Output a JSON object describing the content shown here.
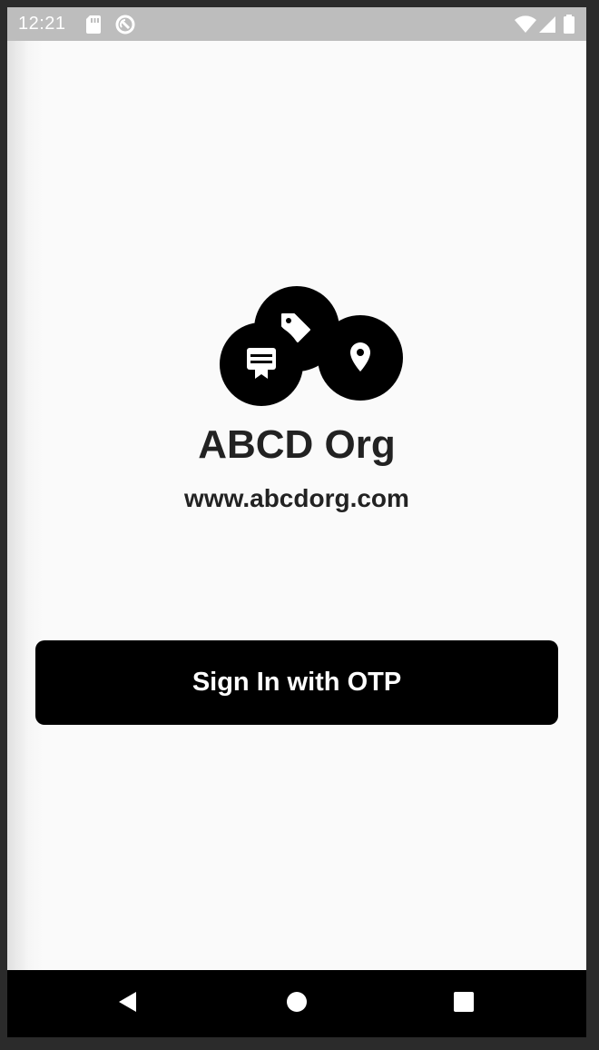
{
  "status_bar": {
    "time": "12:21",
    "left_icons": [
      "sd-card-icon",
      "sync-disabled-icon"
    ],
    "right_icons": [
      "wifi-icon",
      "cell-signal-icon",
      "battery-icon"
    ]
  },
  "app": {
    "logo_icons": [
      "tag-icon",
      "card-ribbon-icon",
      "location-pin-icon"
    ],
    "org_name": "ABCD Org",
    "org_url": "www.abcdorg.com",
    "signin_label": "Sign In with OTP"
  },
  "nav_bar": {
    "buttons": [
      "back-icon",
      "home-icon",
      "recents-icon"
    ]
  },
  "colors": {
    "status_bar_bg": "#bdbdbd",
    "screen_bg": "#fafafa",
    "button_bg": "#000000",
    "button_text": "#ffffff",
    "title_text": "#222222",
    "nav_bar_bg": "#000000"
  }
}
